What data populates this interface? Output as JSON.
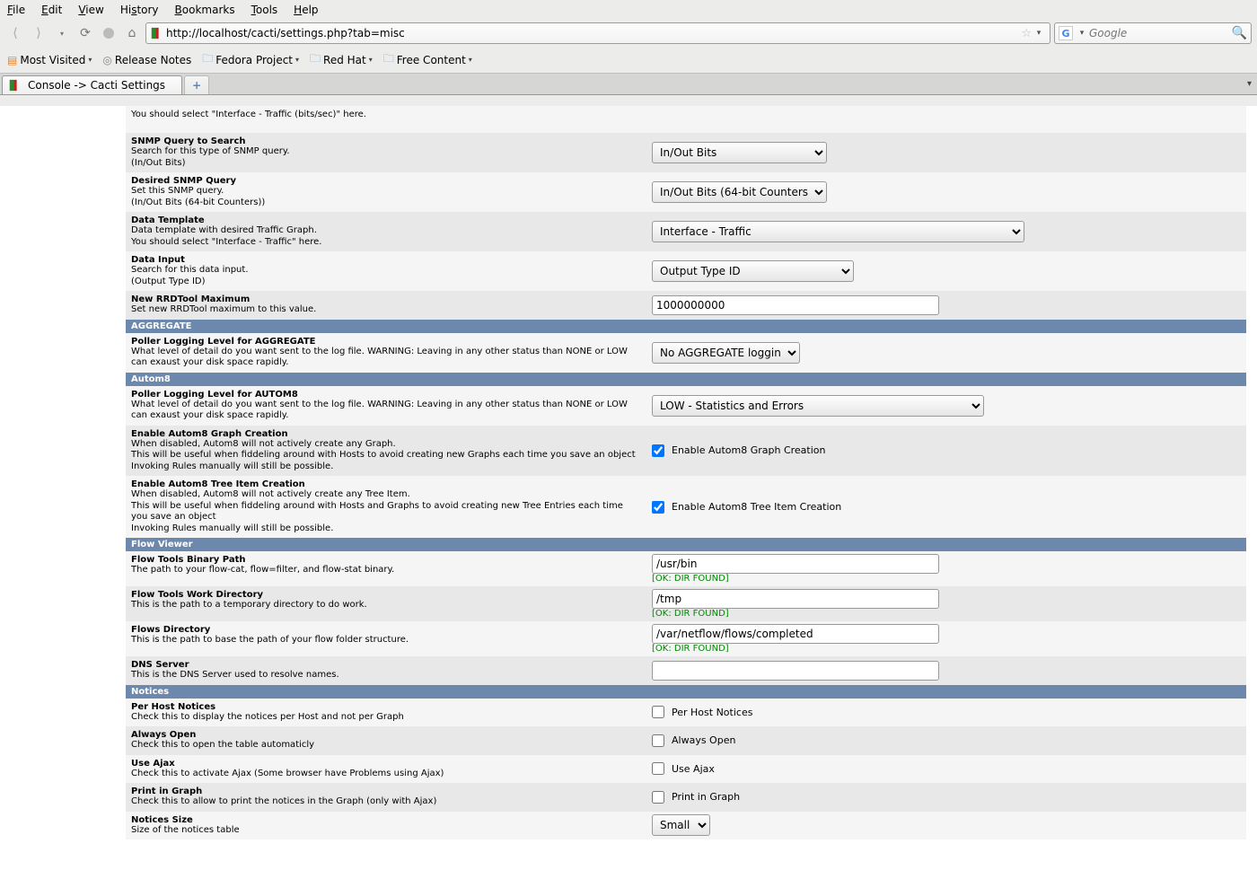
{
  "menu": {
    "file": "File",
    "edit": "Edit",
    "view": "View",
    "history": "History",
    "bookmarks": "Bookmarks",
    "tools": "Tools",
    "help": "Help"
  },
  "url": "http://localhost/cacti/settings.php?tab=misc",
  "search_placeholder": "Google",
  "bookmarks": {
    "most": "Most Visited",
    "release": "Release Notes",
    "fedora": "Fedora Project",
    "redhat": "Red Hat",
    "free": "Free Content"
  },
  "tab_title": "Console -> Cacti Settings",
  "rows": {
    "r0_desc": "You should select \"Interface - Traffic (bits/sec)\" here.",
    "r1_title": "SNMP Query to Search",
    "r1_d1": "Search for this type of SNMP query.",
    "r1_d2": "(In/Out Bits)",
    "r1_val": "In/Out Bits",
    "r2_title": "Desired SNMP Query",
    "r2_d1": "Set this SNMP query.",
    "r2_d2": "(In/Out Bits (64-bit Counters))",
    "r2_val": "In/Out Bits (64-bit Counters)",
    "r3_title": "Data Template",
    "r3_d1": "Data template with desired Traffic Graph.",
    "r3_d2": "You should select \"Interface - Traffic\" here.",
    "r3_val": "Interface - Traffic",
    "r4_title": "Data Input",
    "r4_d1": "Search for this data input.",
    "r4_d2": "(Output Type ID)",
    "r4_val": "Output Type ID",
    "r5_title": "New RRDTool Maximum",
    "r5_d1": "Set new RRDTool maximum to this value.",
    "r5_val": "1000000000",
    "sec_agg": "AGGREGATE",
    "r6_title": "Poller Logging Level for AGGREGATE",
    "r6_d1": "What level of detail do you want sent to the log file. WARNING: Leaving in any other status than NONE or LOW can exaust your disk space rapidly.",
    "r6_val": "No AGGREGATE logging",
    "sec_autom8": "Autom8",
    "r7_title": "Poller Logging Level for AUTOM8",
    "r7_d1": "What level of detail do you want sent to the log file. WARNING: Leaving in any other status than NONE or LOW can exaust your disk space rapidly.",
    "r7_val": "LOW - Statistics and Errors",
    "r8_title": "Enable Autom8 Graph Creation",
    "r8_d1": "When disabled, Autom8 will not actively create any Graph.",
    "r8_d2": "This will be useful when fiddeling around with Hosts to avoid creating new Graphs each time you save an object",
    "r8_d3": "Invoking Rules manually will still be possible.",
    "r8_lbl": "Enable Autom8 Graph Creation",
    "r9_title": "Enable Autom8 Tree Item Creation",
    "r9_d1": "When disabled, Autom8 will not actively create any Tree Item.",
    "r9_d2": "This will be useful when fiddeling around with Hosts and Graphs to avoid creating new Tree Entries each time you save an object",
    "r9_d3": "Invoking Rules manually will still be possible.",
    "r9_lbl": "Enable Autom8 Tree Item Creation",
    "sec_flow": "Flow Viewer",
    "r10_title": "Flow Tools Binary Path",
    "r10_d1": "The path to your flow-cat, flow=filter, and flow-stat binary.",
    "r10_val": "/usr/bin",
    "r10_ok": "[OK: DIR FOUND]",
    "r11_title": "Flow Tools Work Directory",
    "r11_d1": "This is the path to a temporary directory to do work.",
    "r11_val": "/tmp",
    "r11_ok": "[OK: DIR FOUND]",
    "r12_title": "Flows Directory",
    "r12_d1": "This is the path to base the path of your flow folder structure.",
    "r12_val": "/var/netflow/flows/completed",
    "r12_ok": "[OK: DIR FOUND]",
    "r13_title": "DNS Server",
    "r13_d1": "This is the DNS Server used to resolve names.",
    "r13_val": "",
    "sec_notices": "Notices",
    "r14_title": "Per Host Notices",
    "r14_d1": "Check this to display the notices per Host and not per Graph",
    "r14_lbl": "Per Host Notices",
    "r15_title": "Always Open",
    "r15_d1": "Check this to open the table automaticly",
    "r15_lbl": "Always Open",
    "r16_title": "Use Ajax",
    "r16_d1": "Check this to activate Ajax (Some browser have Problems using Ajax)",
    "r16_lbl": "Use Ajax",
    "r17_title": "Print in Graph",
    "r17_d1": "Check this to allow to print the notices in the Graph (only with Ajax)",
    "r17_lbl": "Print in Graph",
    "r18_title": "Notices Size",
    "r18_d1": "Size of the notices table",
    "r18_val": "Small"
  }
}
